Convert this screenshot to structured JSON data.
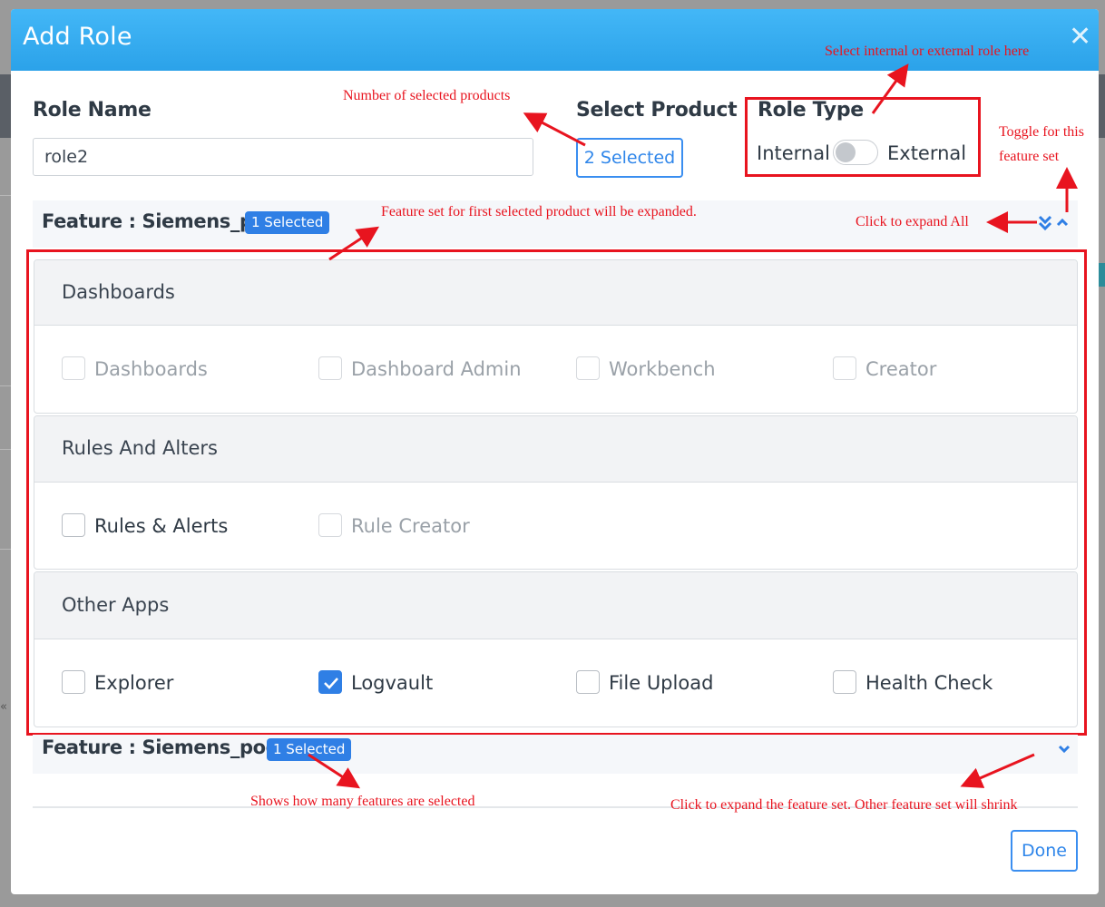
{
  "modal": {
    "title": "Add Role",
    "close_icon": "close-icon"
  },
  "form": {
    "role_name_label": "Role Name",
    "role_name_value": "role2",
    "select_product_label": "Select Product",
    "select_product_value": "2 Selected",
    "role_type_label": "Role Type",
    "role_type_left": "Internal",
    "role_type_right": "External",
    "role_type_external_on": false
  },
  "features": [
    {
      "title": "Feature : Siemens_pod",
      "badge": "1 Selected",
      "expanded": true,
      "groups": [
        {
          "title": "Dashboards",
          "items": [
            {
              "label": "Dashboards",
              "checked": false,
              "enabled": false
            },
            {
              "label": "Dashboard Admin",
              "checked": false,
              "enabled": false
            },
            {
              "label": "Workbench",
              "checked": false,
              "enabled": false
            },
            {
              "label": "Creator",
              "checked": false,
              "enabled": false
            }
          ]
        },
        {
          "title": "Rules And Alters",
          "items": [
            {
              "label": "Rules & Alerts",
              "checked": false,
              "enabled": true
            },
            {
              "label": "Rule Creator",
              "checked": false,
              "enabled": false
            }
          ]
        },
        {
          "title": "Other Apps",
          "items": [
            {
              "label": "Explorer",
              "checked": false,
              "enabled": true
            },
            {
              "label": "Logvault",
              "checked": true,
              "enabled": true
            },
            {
              "label": "File Upload",
              "checked": false,
              "enabled": true
            },
            {
              "label": "Health Check",
              "checked": false,
              "enabled": true
            }
          ]
        }
      ]
    },
    {
      "title": "Feature : Siemens_pod80",
      "badge": "1 Selected",
      "expanded": false
    }
  ],
  "footer": {
    "done_label": "Done"
  },
  "annotations": {
    "role_type_note": "Select internal or external role here",
    "product_count_note": "Number of selected products",
    "toggle_note_line1": "Toggle for this",
    "toggle_note_line2": "feature set",
    "first_expanded_note": "Feature set for first selected product will be expanded.",
    "expand_all_note": "Click to expand All",
    "badge_note": "Shows how many features are selected",
    "expand_feature_note": "Click to expand the feature set. Other feature set will shrink"
  },
  "colors": {
    "header": "#2ba2e9",
    "accent": "#2f7fe5",
    "annotation": "#e8141f"
  }
}
